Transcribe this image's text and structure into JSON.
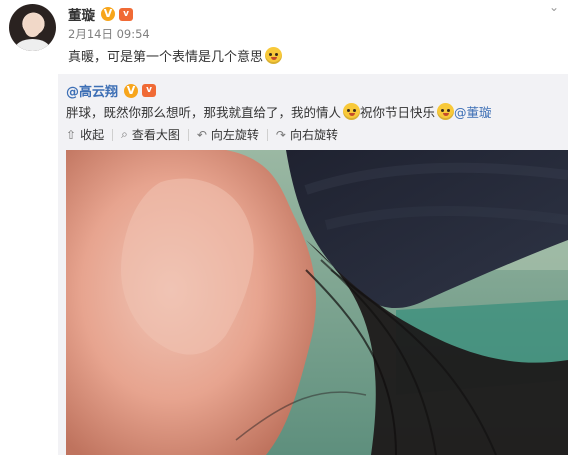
{
  "post": {
    "author": "董璇",
    "verified_badge": "V",
    "vip_badge": "vip",
    "timestamp": "2月14日 09:54",
    "text": "真暖，可是第一个表情是几个意思",
    "expand_icon": "chevron-down-icon"
  },
  "repost": {
    "author": "@高云翔",
    "verified_badge": "V",
    "text_part1": "胖球，既然你那么想听，那我就直给了，我的情人",
    "text_part2": "祝你节日快乐",
    "mention": "@董璇",
    "toolbar": {
      "collapse": "收起",
      "view_large": "查看大图",
      "rotate_left": "向左旋转",
      "rotate_right": "向右旋转"
    }
  },
  "colors": {
    "accent": "#3d6fb5",
    "badge": "#f7a51b",
    "repost_bg": "#f2f2f5"
  }
}
